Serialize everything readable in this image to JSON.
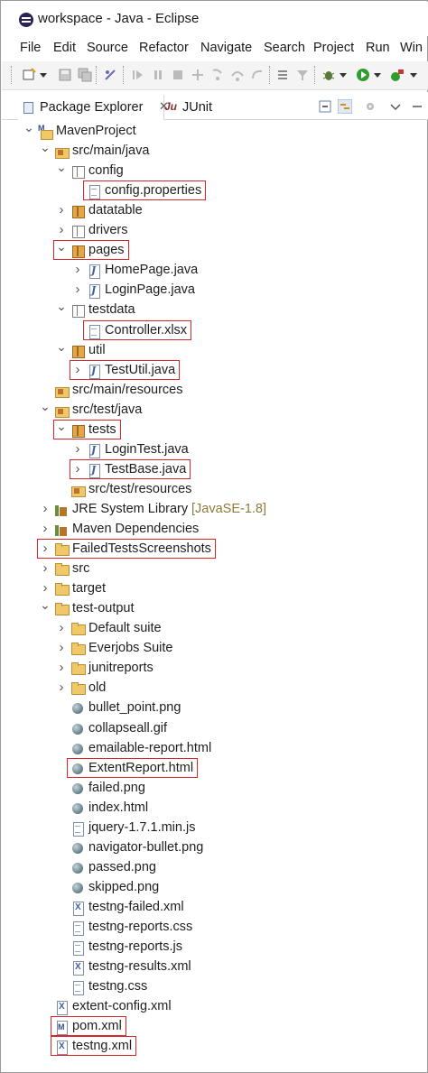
{
  "window": {
    "title": "workspace - Java - Eclipse"
  },
  "menu": [
    "File",
    "Edit",
    "Source",
    "Refactor",
    "Navigate",
    "Search",
    "Project",
    "Run",
    "Win"
  ],
  "tabs": {
    "package_explorer": "Package Explorer",
    "close_glyph": "✕",
    "junit_icon": "Ju",
    "junit": "JUnit"
  },
  "tree": [
    {
      "label": "MavenProject",
      "icon": "project-icon",
      "twisty": "expanded"
    },
    {
      "label": "src/main/java",
      "icon": "source-folder-icon",
      "twisty": "expanded"
    },
    {
      "label": "config",
      "icon": "package-empty-icon",
      "twisty": "expanded"
    },
    {
      "label": "config.properties",
      "icon": "properties-file-icon",
      "twisty": "none",
      "highlighted": true
    },
    {
      "label": "datatable",
      "icon": "package-icon",
      "twisty": "collapsed"
    },
    {
      "label": "drivers",
      "icon": "package-empty-icon",
      "twisty": "collapsed"
    },
    {
      "label": "pages",
      "icon": "package-icon",
      "twisty": "expanded",
      "highlighted": true
    },
    {
      "label": "HomePage.java",
      "icon": "java-file-icon",
      "twisty": "collapsed"
    },
    {
      "label": "LoginPage.java",
      "icon": "java-file-icon",
      "twisty": "collapsed"
    },
    {
      "label": "testdata",
      "icon": "package-empty-icon",
      "twisty": "expanded"
    },
    {
      "label": "Controller.xlsx",
      "icon": "file-icon",
      "twisty": "none",
      "highlighted": true
    },
    {
      "label": "util",
      "icon": "package-icon",
      "twisty": "expanded"
    },
    {
      "label": "TestUtil.java",
      "icon": "java-file-icon",
      "twisty": "collapsed",
      "highlighted": true
    },
    {
      "label": "src/main/resources",
      "icon": "source-folder-icon",
      "twisty": "none"
    },
    {
      "label": "src/test/java",
      "icon": "source-folder-icon",
      "twisty": "expanded"
    },
    {
      "label": "tests",
      "icon": "package-icon",
      "twisty": "expanded",
      "highlighted": true
    },
    {
      "label": "LoginTest.java",
      "icon": "java-file-icon",
      "twisty": "collapsed"
    },
    {
      "label": "TestBase.java",
      "icon": "java-file-icon",
      "twisty": "collapsed",
      "highlighted": true
    },
    {
      "label": "src/test/resources",
      "icon": "source-folder-icon",
      "twisty": "none"
    },
    {
      "label": "JRE System Library",
      "decoration": "[JavaSE-1.8]",
      "icon": "library-icon",
      "twisty": "collapsed"
    },
    {
      "label": "Maven Dependencies",
      "icon": "library-icon",
      "twisty": "collapsed"
    },
    {
      "label": "FailedTestsScreenshots",
      "icon": "folder-icon",
      "twisty": "collapsed",
      "highlighted": true
    },
    {
      "label": "src",
      "icon": "folder-icon",
      "twisty": "collapsed"
    },
    {
      "label": "target",
      "icon": "folder-icon",
      "twisty": "collapsed"
    },
    {
      "label": "test-output",
      "icon": "folder-icon",
      "twisty": "expanded"
    },
    {
      "label": "Default suite",
      "icon": "folder-icon",
      "twisty": "collapsed"
    },
    {
      "label": "Everjobs Suite",
      "icon": "folder-icon",
      "twisty": "collapsed"
    },
    {
      "label": "junitreports",
      "icon": "folder-icon",
      "twisty": "collapsed"
    },
    {
      "label": "old",
      "icon": "folder-icon",
      "twisty": "collapsed"
    },
    {
      "label": "bullet_point.png",
      "icon": "web-file-icon",
      "twisty": "none"
    },
    {
      "label": "collapseall.gif",
      "icon": "web-file-icon",
      "twisty": "none"
    },
    {
      "label": "emailable-report.html",
      "icon": "web-file-icon",
      "twisty": "none"
    },
    {
      "label": "ExtentReport.html",
      "icon": "web-file-icon",
      "twisty": "none",
      "highlighted": true
    },
    {
      "label": "failed.png",
      "icon": "web-file-icon",
      "twisty": "none"
    },
    {
      "label": "index.html",
      "icon": "web-file-icon",
      "twisty": "none"
    },
    {
      "label": "jquery-1.7.1.min.js",
      "icon": "file-icon",
      "twisty": "none"
    },
    {
      "label": "navigator-bullet.png",
      "icon": "web-file-icon",
      "twisty": "none"
    },
    {
      "label": "passed.png",
      "icon": "web-file-icon",
      "twisty": "none"
    },
    {
      "label": "skipped.png",
      "icon": "web-file-icon",
      "twisty": "none"
    },
    {
      "label": "testng-failed.xml",
      "icon": "xml-file-icon",
      "twisty": "none"
    },
    {
      "label": "testng-reports.css",
      "icon": "file-icon",
      "twisty": "none"
    },
    {
      "label": "testng-reports.js",
      "icon": "file-icon",
      "twisty": "none"
    },
    {
      "label": "testng-results.xml",
      "icon": "xml-file-icon",
      "twisty": "none"
    },
    {
      "label": "testng.css",
      "icon": "file-icon",
      "twisty": "none"
    },
    {
      "label": "extent-config.xml",
      "icon": "xml-file-icon",
      "twisty": "none"
    },
    {
      "label": "pom.xml",
      "icon": "pom-file-icon",
      "twisty": "none",
      "highlighted": true
    },
    {
      "label": "testng.xml",
      "icon": "xml-file-icon",
      "twisty": "none",
      "highlighted": true
    }
  ],
  "colors": {
    "highlight_border": "#d9262b",
    "decoration_text": "#8b7a3a",
    "toolbar_bg": "#f4f4f4"
  }
}
